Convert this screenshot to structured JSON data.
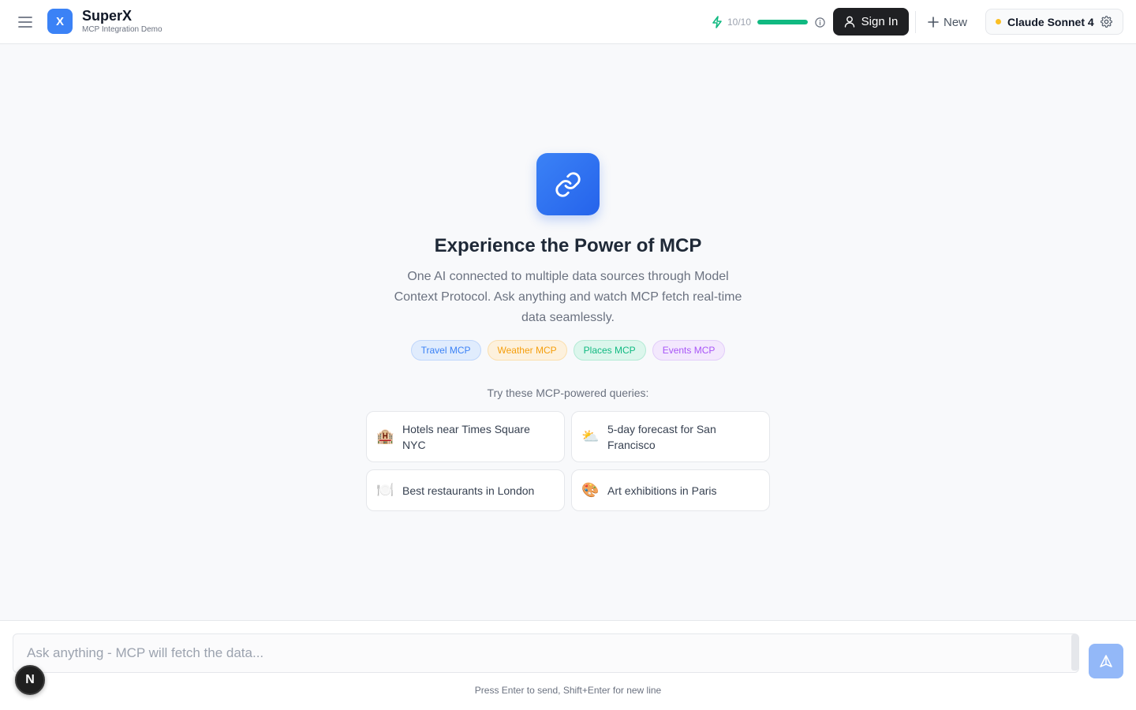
{
  "header": {
    "brand": {
      "logo_letter": "X",
      "name": "SuperX",
      "subtitle": "MCP Integration Demo"
    },
    "usage": {
      "text": "10/10",
      "fraction": 1.0,
      "bar_color": "#10b981"
    },
    "signin_label": "Sign In",
    "new_label": "New",
    "model": {
      "name": "Claude Sonnet 4",
      "status_color": "#fbbf24"
    }
  },
  "hero": {
    "title": "Experience the Power of MCP",
    "description": "One AI connected to multiple data sources through Model Context Protocol. Ask anything and watch MCP fetch real-time data seamlessly.",
    "tags": [
      {
        "label": "Travel MCP"
      },
      {
        "label": "Weather MCP"
      },
      {
        "label": "Places MCP"
      },
      {
        "label": "Events MCP"
      }
    ]
  },
  "queries": {
    "label": "Try these MCP-powered queries:",
    "items": [
      {
        "emoji": "🏨",
        "text": "Hotels near Times Square NYC"
      },
      {
        "emoji": "⛅",
        "text": "5-day forecast for San Francisco"
      },
      {
        "emoji": "🍽️",
        "text": "Best restaurants in London"
      },
      {
        "emoji": "🎨",
        "text": "Art exhibitions in Paris"
      }
    ]
  },
  "composer": {
    "placeholder": "Ask anything - MCP will fetch the data...",
    "hint": "Press Enter to send, Shift+Enter for new line"
  },
  "badge": {
    "letter": "N"
  },
  "colors": {
    "accent": "#3b82f6",
    "signin_bg": "#1f2023",
    "send_bg": "#93b8f8"
  }
}
